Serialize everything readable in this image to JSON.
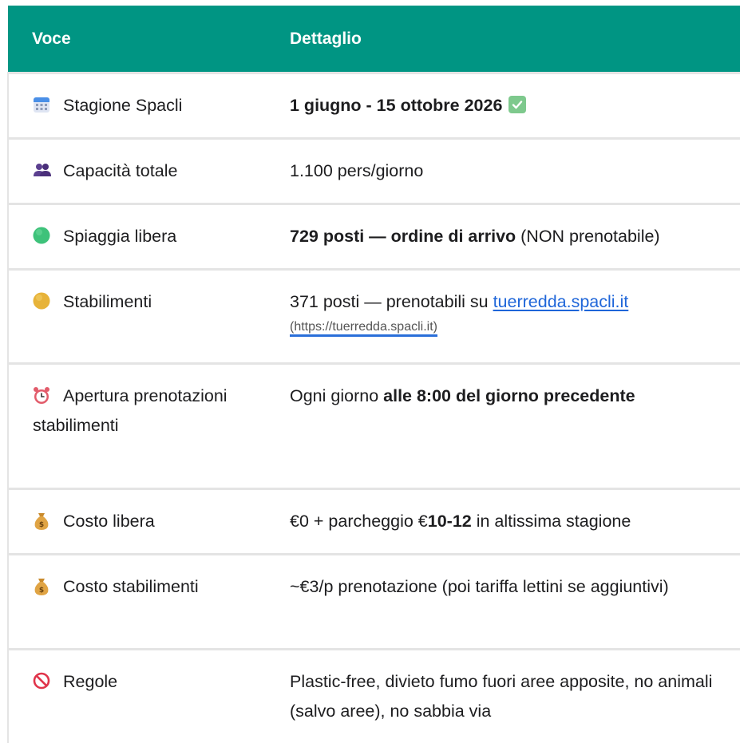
{
  "header": {
    "col1": "Voce",
    "col2": "Dettaglio"
  },
  "colors": {
    "header_bg": "#009583",
    "link": "#1f66d9",
    "border": "#e4e4e4"
  },
  "rows": [
    {
      "icon": "calendar-icon",
      "label": "Stagione Spacli",
      "detail_bold": "1 giugno - 15 ottobre 2026",
      "detail_icon": "check-mark-icon"
    },
    {
      "icon": "people-icon",
      "label": "Capacità totale",
      "detail": "1.100 pers/giorno"
    },
    {
      "icon": "green-circle-icon",
      "label": "Spiaggia libera",
      "detail_bold": "729 posti — ordine di arrivo",
      "detail_rest": " (NON prenotabile)"
    },
    {
      "icon": "yellow-circle-icon",
      "label": "Stabilimenti",
      "detail_pre": "371 posti — prenotabili su ",
      "link_text": "tuerredda.spacli.it",
      "link_url_text": "(https://tuerredda.spacli.it)"
    },
    {
      "icon": "alarm-clock-icon",
      "label": "Apertura prenotazioni stabilimenti",
      "detail_pre": "Ogni giorno ",
      "detail_bold": "alle 8:00 del giorno precedente"
    },
    {
      "icon": "money-bag-icon",
      "label": "Costo libera",
      "detail_pre": "€0 + parcheggio €",
      "detail_bold": "10-12",
      "detail_rest": " in altissima stagione"
    },
    {
      "icon": "money-bag-icon",
      "label": "Costo stabilimenti",
      "detail": "~€3/p prenotazione (poi tariffa lettini se aggiuntivi)"
    },
    {
      "icon": "prohibited-icon",
      "label": "Regole",
      "detail": "Plastic-free, divieto fumo fuori aree apposite, no animali (salvo aree), no sabbia via"
    }
  ]
}
